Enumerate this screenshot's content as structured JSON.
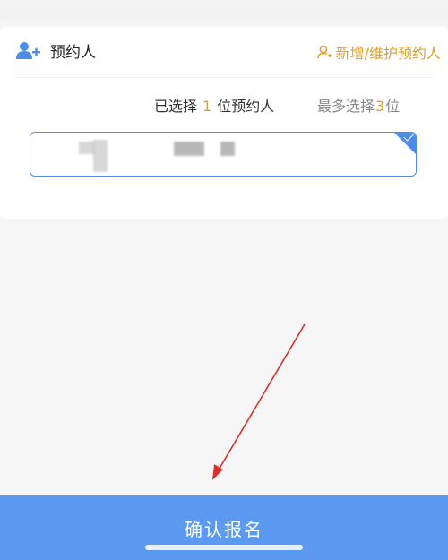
{
  "section": {
    "title": "预约人",
    "manage_label": "新增/维护预约人"
  },
  "selection": {
    "prefix": "已选择",
    "selected_count": "1",
    "suffix": "位预约人",
    "max_prefix": "最多选择",
    "max_count": "3",
    "max_suffix": "位"
  },
  "confirm": {
    "label": "确认报名"
  },
  "colors": {
    "accent_blue": "#5b9af0",
    "accent_orange": "#e0a22a",
    "annotation_red": "#d9302c"
  },
  "icons": {
    "section_icon": "person-add-icon",
    "manage_icon": "person-outline-icon"
  }
}
